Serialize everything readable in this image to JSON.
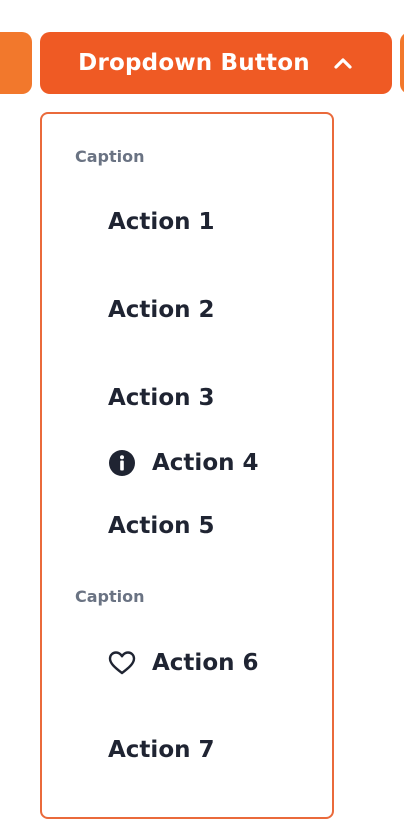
{
  "button": {
    "label": "Dropdown Button",
    "icon": "chevron-up-icon",
    "color": "#ef5a24"
  },
  "menu": {
    "border_color": "#ea6a3b",
    "captions": [
      "Caption",
      "Caption"
    ],
    "items": [
      {
        "label": "Action 1"
      },
      {
        "label": "Action 2"
      },
      {
        "label": "Action 3"
      },
      {
        "label": "Action 4",
        "icon": "info-icon"
      },
      {
        "label": "Action 5"
      },
      {
        "label": "Action 6",
        "icon": "heart-icon"
      },
      {
        "label": "Action 7"
      }
    ]
  }
}
